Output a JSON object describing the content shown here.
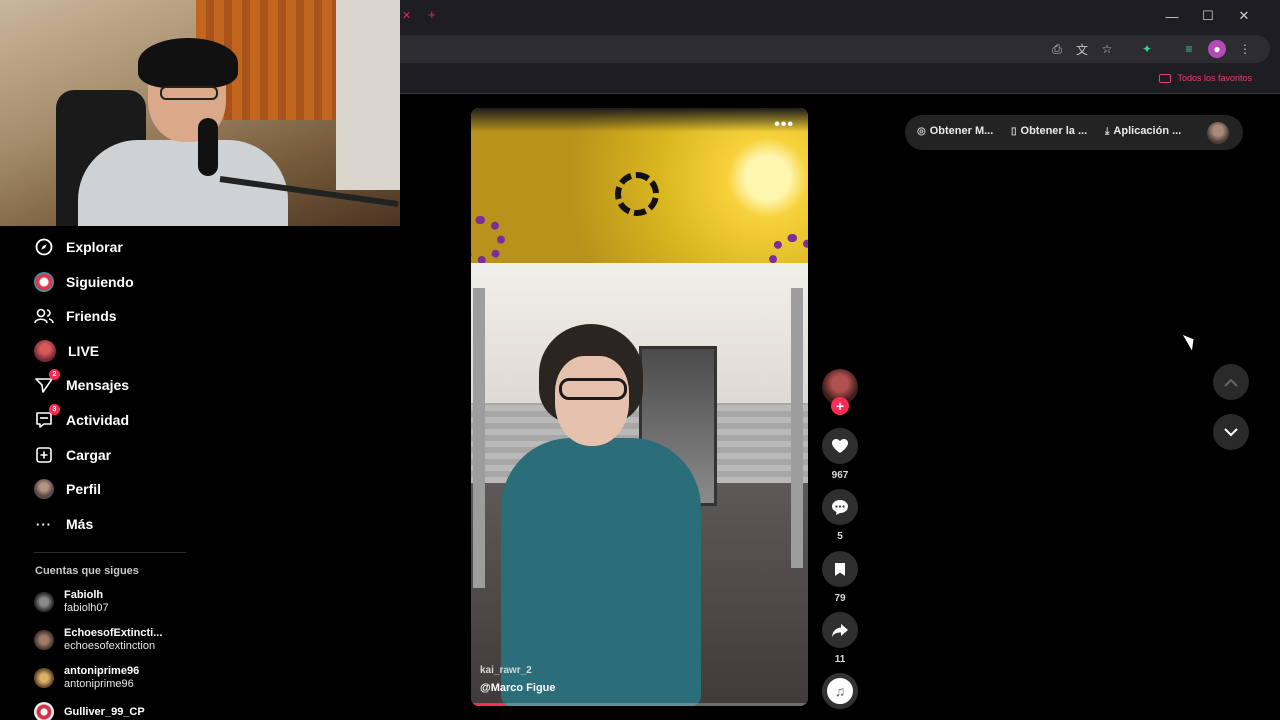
{
  "browser": {
    "bookmark_folder": "Todos los favoritos",
    "window_controls": [
      "minimize-icon",
      "maximize-icon",
      "close-icon"
    ]
  },
  "sidebar": {
    "items": [
      {
        "label": "Explorar",
        "icon": "compass-icon"
      },
      {
        "label": "Siguiendo",
        "icon": "avatar-icon"
      },
      {
        "label": "Friends",
        "icon": "friends-icon"
      },
      {
        "label": "LIVE",
        "icon": "live-icon"
      },
      {
        "label": "Mensajes",
        "icon": "send-icon",
        "badge": "2"
      },
      {
        "label": "Actividad",
        "icon": "activity-icon",
        "badge": "3"
      },
      {
        "label": "Cargar",
        "icon": "upload-icon"
      },
      {
        "label": "Perfil",
        "icon": "profile-avatar-icon"
      },
      {
        "label": "Más",
        "icon": "more-icon"
      }
    ],
    "following_title": "Cuentas que sigues",
    "following": [
      {
        "name": "Fabiolh",
        "handle": "fabiolh07"
      },
      {
        "name": "EchoesofExtincti...",
        "handle": "echoesofextinction"
      },
      {
        "name": "antoniprime96",
        "handle": "antoniprime96"
      },
      {
        "name": "Gulliver_99_CP",
        "handle": ""
      }
    ]
  },
  "video": {
    "author": "kai_rawr_2",
    "mention": "@Marco Figue",
    "more_label": "•••",
    "progress": 0.1
  },
  "actions": {
    "likes": "967",
    "comments": "5",
    "saves": "79",
    "shares": "11",
    "follow_label": "+"
  },
  "top_actions": {
    "items": [
      {
        "label": "Obtener M...",
        "icon": "coin-icon"
      },
      {
        "label": "Obtener la ...",
        "icon": "phone-icon"
      },
      {
        "label": "Aplicación ...",
        "icon": "download-icon"
      }
    ]
  },
  "colors": {
    "accent": "#fe2c55",
    "background": "#000000",
    "chrome": "#1e1e22"
  }
}
